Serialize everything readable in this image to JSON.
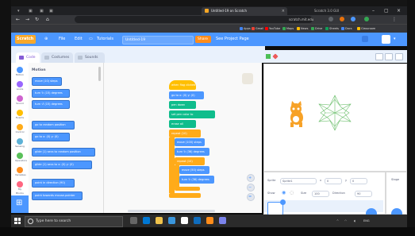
{
  "browser": {
    "active_tab_title": "Untitled-19 on Scratch",
    "second_tab_title": "Scratch 3.0 GUI",
    "url": "scratch.mit.edu",
    "bookmarks": [
      "Apps",
      "Gmail",
      "YouTube",
      "Maps",
      "News",
      "Drive",
      "Sheets",
      "Docs",
      "Classroom"
    ]
  },
  "menubar": {
    "logo": "Scratch",
    "items": [
      "File",
      "Edit",
      "Tutorials"
    ],
    "project_title": "Untitled-19",
    "share": "Share",
    "see_project": "See Project Page"
  },
  "editor_tabs": [
    "Code",
    "Costumes",
    "Sounds"
  ],
  "categories": [
    {
      "label": "Motion",
      "color": "#4c97ff"
    },
    {
      "label": "Looks",
      "color": "#9966ff"
    },
    {
      "label": "Sound",
      "color": "#cf63cf"
    },
    {
      "label": "Events",
      "color": "#ffbf00"
    },
    {
      "label": "Control",
      "color": "#ffab19"
    },
    {
      "label": "Sensing",
      "color": "#5cb1d6"
    },
    {
      "label": "Operators",
      "color": "#59c059"
    },
    {
      "label": "Variables",
      "color": "#ff8c1a"
    },
    {
      "label": "My Blocks",
      "color": "#ff6680"
    },
    {
      "label": "Pen",
      "color": "#0fbd8c"
    }
  ],
  "palette": {
    "header": "Motion",
    "blocks": [
      "move (10) steps",
      "turn ↻ (15) degrees",
      "turn ↺ (15) degrees",
      "go to random position",
      "go to x: (0) y: (0)",
      "glide (1) secs to random position",
      "glide (1) secs to x: (0) y: (0)",
      "point in direction (90)",
      "point towards mouse-pointer"
    ]
  },
  "script": {
    "blocks": [
      "when flag clicked",
      "go to x: (0) y: (0)",
      "pen down",
      "set pen color to",
      "erase all",
      "repeat (10)",
      "move (100) steps",
      "turn ↻ (36) degrees",
      "repeat (10)",
      "move (50) steps",
      "turn ↻ (36) degrees"
    ]
  },
  "sprite_info": {
    "sprite_label": "Sprite",
    "sprite_name": "Sprite1",
    "x_label": "x",
    "x_value": "0",
    "y_label": "y",
    "y_value": "0",
    "show_label": "Show",
    "size_label": "Size",
    "size_value": "100",
    "direction_label": "Direction",
    "direction_value": "90"
  },
  "stage_panel": {
    "label": "Stage"
  },
  "taskbar": {
    "search_placeholder": "Type here to search",
    "time": "",
    "date": ""
  },
  "colors": {
    "scratch_blue": "#4c97ff",
    "event_yellow": "#ffbf00",
    "control_orange": "#ffab19",
    "pen_green": "#0fbd8c"
  }
}
